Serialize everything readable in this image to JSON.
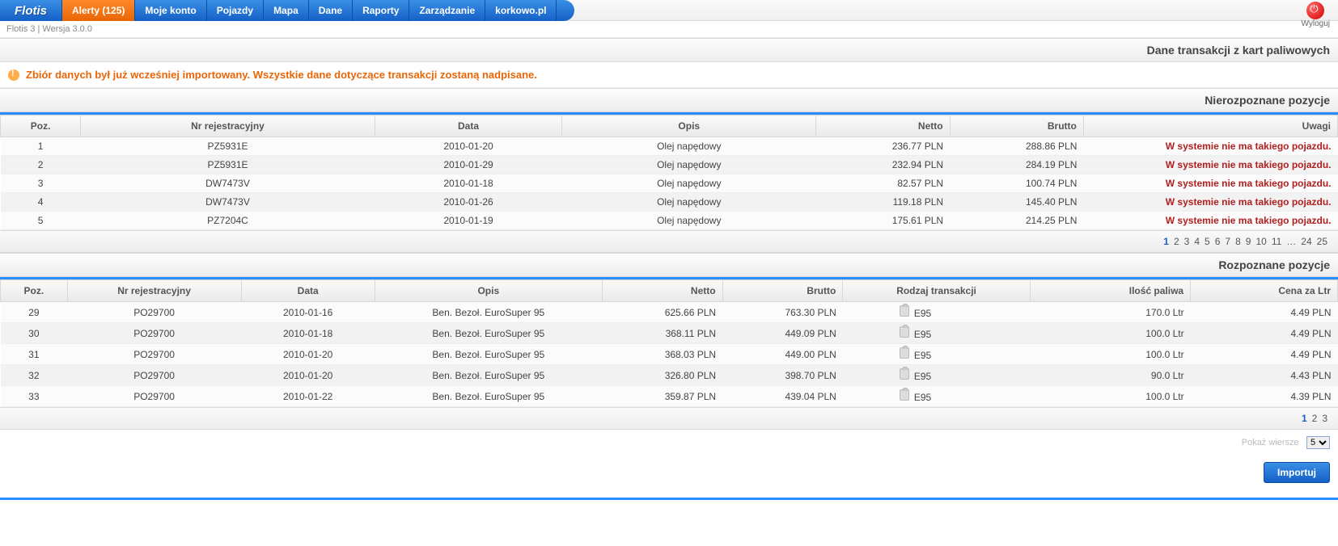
{
  "brand": "Flotis",
  "nav": {
    "alerts": "Alerty (125)",
    "account": "Moje konto",
    "vehicles": "Pojazdy",
    "map": "Mapa",
    "data": "Dane",
    "reports": "Raporty",
    "manage": "Zarządzanie",
    "korkowo": "korkowo.pl"
  },
  "logout": "Wyloguj",
  "version": "Flotis 3 | Wersja 3.0.0",
  "page_title": "Dane transakcji z kart paliwowych",
  "warning_msg": "Zbiór danych był już wcześniej importowany. Wszystkie dane dotyczące transakcji zostaną nadpisane.",
  "section1_title": "Nierozpoznane pozycje",
  "section2_title": "Rozpoznane pozycje",
  "tbl1": {
    "cols": {
      "pos": "Poz.",
      "reg": "Nr rejestracyjny",
      "date": "Data",
      "desc": "Opis",
      "net": "Netto",
      "gross": "Brutto",
      "notes": "Uwagi"
    },
    "rows": [
      {
        "pos": "1",
        "reg": "PZ5931E",
        "date": "2010-01-20",
        "desc": "Olej napędowy",
        "net": "236.77 PLN",
        "gross": "288.86 PLN",
        "notes": "W systemie nie ma takiego pojazdu."
      },
      {
        "pos": "2",
        "reg": "PZ5931E",
        "date": "2010-01-29",
        "desc": "Olej napędowy",
        "net": "232.94 PLN",
        "gross": "284.19 PLN",
        "notes": "W systemie nie ma takiego pojazdu."
      },
      {
        "pos": "3",
        "reg": "DW7473V",
        "date": "2010-01-18",
        "desc": "Olej napędowy",
        "net": "82.57 PLN",
        "gross": "100.74 PLN",
        "notes": "W systemie nie ma takiego pojazdu."
      },
      {
        "pos": "4",
        "reg": "DW7473V",
        "date": "2010-01-26",
        "desc": "Olej napędowy",
        "net": "119.18 PLN",
        "gross": "145.40 PLN",
        "notes": "W systemie nie ma takiego pojazdu."
      },
      {
        "pos": "5",
        "reg": "PZ7204C",
        "date": "2010-01-19",
        "desc": "Olej napędowy",
        "net": "175.61 PLN",
        "gross": "214.25 PLN",
        "notes": "W systemie nie ma takiego pojazdu."
      }
    ],
    "pager": [
      "1",
      "2",
      "3",
      "4",
      "5",
      "6",
      "7",
      "8",
      "9",
      "10",
      "11",
      "…",
      "24",
      "25"
    ],
    "current_page": "1"
  },
  "tbl2": {
    "cols": {
      "pos": "Poz.",
      "reg": "Nr rejestracyjny",
      "date": "Data",
      "desc": "Opis",
      "net": "Netto",
      "gross": "Brutto",
      "type": "Rodzaj transakcji",
      "qty": "Ilość paliwa",
      "price": "Cena za Ltr"
    },
    "rows": [
      {
        "pos": "29",
        "reg": "PO29700",
        "date": "2010-01-16",
        "desc": "Ben. Bezoł. EuroSuper 95",
        "net": "625.66 PLN",
        "gross": "763.30 PLN",
        "type": "E95",
        "qty": "170.0 Ltr",
        "price": "4.49 PLN"
      },
      {
        "pos": "30",
        "reg": "PO29700",
        "date": "2010-01-18",
        "desc": "Ben. Bezoł. EuroSuper 95",
        "net": "368.11 PLN",
        "gross": "449.09 PLN",
        "type": "E95",
        "qty": "100.0 Ltr",
        "price": "4.49 PLN"
      },
      {
        "pos": "31",
        "reg": "PO29700",
        "date": "2010-01-20",
        "desc": "Ben. Bezoł. EuroSuper 95",
        "net": "368.03 PLN",
        "gross": "449.00 PLN",
        "type": "E95",
        "qty": "100.0 Ltr",
        "price": "4.49 PLN"
      },
      {
        "pos": "32",
        "reg": "PO29700",
        "date": "2010-01-20",
        "desc": "Ben. Bezoł. EuroSuper 95",
        "net": "326.80 PLN",
        "gross": "398.70 PLN",
        "type": "E95",
        "qty": "90.0 Ltr",
        "price": "4.43 PLN"
      },
      {
        "pos": "33",
        "reg": "PO29700",
        "date": "2010-01-22",
        "desc": "Ben. Bezoł. EuroSuper 95",
        "net": "359.87 PLN",
        "gross": "439.04 PLN",
        "type": "E95",
        "qty": "100.0 Ltr",
        "price": "4.39 PLN"
      }
    ],
    "pager": [
      "1",
      "2",
      "3"
    ],
    "current_page": "1"
  },
  "rows_label": "Pokaż wiersze",
  "rows_value": "5",
  "import_btn": "Importuj"
}
